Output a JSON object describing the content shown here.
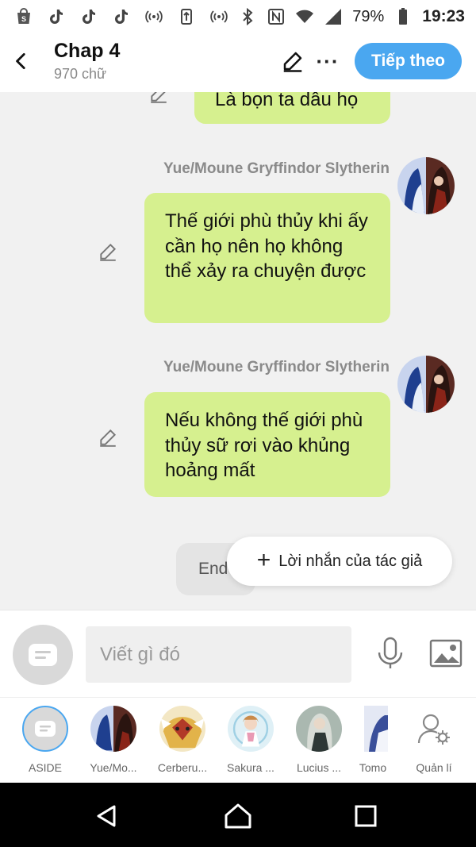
{
  "status_bar": {
    "battery_percent": "79%",
    "time": "19:23"
  },
  "header": {
    "title": "Chap 4",
    "word_count": "970 chữ",
    "next_label": "Tiếp theo"
  },
  "chat": {
    "messages": [
      {
        "sender": "",
        "text": "Là bọn ta dâu họ"
      },
      {
        "sender": "Yue/Moune Gryffindor Slytherin",
        "text": "Thế giới phù thủy khi ấy cần họ nên họ không thể xảy ra chuyện được"
      },
      {
        "sender": "Yue/Moune Gryffindor Slytherin",
        "text": "Nếu không thế giới phù thủy sữ rơi vào khủng hoảng mất"
      }
    ],
    "end_chip": "End",
    "author_note_label": "Lời nhắn của tác giả"
  },
  "composer": {
    "placeholder": "Viết gì đó"
  },
  "characters": [
    {
      "label": "ASIDE"
    },
    {
      "label": "Yue/Mo..."
    },
    {
      "label": "Cerberu..."
    },
    {
      "label": "Sakura ..."
    },
    {
      "label": "Lucius ..."
    },
    {
      "label": "Tomo"
    },
    {
      "label": "Quản lí"
    }
  ],
  "colors": {
    "accent": "#4aa7f0",
    "bubble": "#d6f08f",
    "background": "#f1f1f1"
  }
}
